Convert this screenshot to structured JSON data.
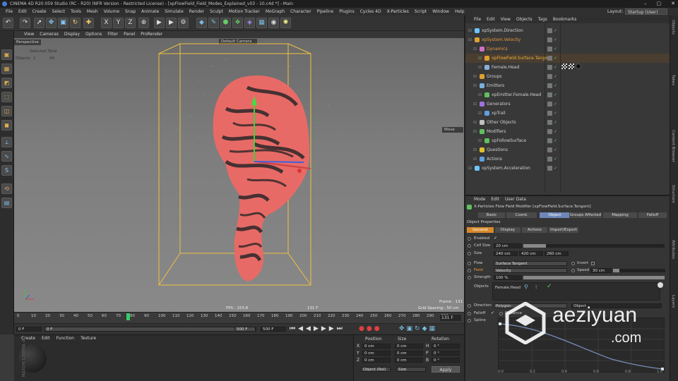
{
  "window": {
    "title": "CINEMA 4D R20.059 Studio (RC - R20) (NFR Version - Restricted License) - [xpFlowField_Field_Modes_Explained_v03 - 10.c4d *] - Main",
    "min": "–",
    "max": "▢",
    "close": "✕"
  },
  "menu": [
    "File",
    "Edit",
    "Create",
    "Select",
    "Tools",
    "Mesh",
    "Volume",
    "Snap",
    "Animate",
    "Simulate",
    "Render",
    "Sculpt",
    "Motion Tracker",
    "MoGraph",
    "Character",
    "Pipeline",
    "Plugins",
    "Cycles 4D",
    "X-Particles",
    "Script",
    "Window",
    "Help"
  ],
  "layout": {
    "label": "Layout:",
    "value": "Startup (User)"
  },
  "viewport": {
    "menu": [
      "View",
      "Cameras",
      "Display",
      "Options",
      "Filter",
      "Panel",
      "ProRender"
    ],
    "name": "Perspective",
    "camera": "Default Camera",
    "stats_header": "Selected Total",
    "stats_label": "Objects",
    "stats_selected": "1",
    "stats_total": "40",
    "fps": "FPS : 153.8",
    "frame": "Frame : 131",
    "frame_mid": "131 F",
    "grid": "Grid Spacing : 50 cm",
    "move": "Move"
  },
  "timeline": {
    "ticks": [
      "0",
      "10",
      "20",
      "30",
      "40",
      "50",
      "60",
      "70",
      "80",
      "90",
      "100",
      "110",
      "120",
      "130",
      "140",
      "150",
      "160",
      "170",
      "180",
      "190",
      "200",
      "210",
      "220",
      "230",
      "240",
      "250",
      "260",
      "270",
      "280",
      "290",
      "300"
    ],
    "current": "131 F"
  },
  "playback": {
    "start": "0 F",
    "min": "0 F",
    "max": "500 F",
    "end": "500 F"
  },
  "material": {
    "menu": [
      "Create",
      "Edit",
      "Function",
      "Texture"
    ],
    "brand": "MAXON CINEMA 4D"
  },
  "coords": {
    "headers": [
      "Position",
      "Size",
      "Rotation"
    ],
    "rows": [
      {
        "axis": "X",
        "pos": "0 cm",
        "size": "0 cm",
        "rotlabel": "H",
        "rot": "0 °"
      },
      {
        "axis": "Y",
        "pos": "0 cm",
        "size": "0 cm",
        "rotlabel": "P",
        "rot": "0 °"
      },
      {
        "axis": "Z",
        "pos": "0 cm",
        "size": "0 cm",
        "rotlabel": "B",
        "rot": "0 °"
      }
    ],
    "mode": "Object (Rel)",
    "sizemode": "Size",
    "apply": "Apply"
  },
  "objects": {
    "menu": [
      "File",
      "Edit",
      "View",
      "Objects",
      "Tags",
      "Bookmarks"
    ],
    "items": [
      {
        "name": "xpSystem.Direction",
        "indent": 0,
        "color": "#6dc4ff",
        "name_color": "#d0d0d0"
      },
      {
        "name": "xpSystem.Velocity",
        "indent": 0,
        "color": "#e0a030",
        "name_color": "#e89a3a"
      },
      {
        "name": "Dynamics",
        "indent": 1,
        "color": "#d070c0",
        "name_color": "#e89a3a"
      },
      {
        "name": "xpFlowField.Surface.Tangent",
        "indent": 2,
        "color": "#e0a030",
        "name_color": "#f0b040"
      },
      {
        "name": "Female.Head",
        "indent": 2,
        "color": "#8ab0e0",
        "name_color": "#d0d0d0"
      },
      {
        "name": "Groups",
        "indent": 1,
        "color": "#e0a030",
        "name_color": "#d0d0d0"
      },
      {
        "name": "Emitters",
        "indent": 1,
        "color": "#7ab0e0",
        "name_color": "#d0d0d0"
      },
      {
        "name": "xpEmitter.Female.Head",
        "indent": 2,
        "color": "#60c060",
        "name_color": "#d0d0d0"
      },
      {
        "name": "Generators",
        "indent": 1,
        "color": "#a070e0",
        "name_color": "#d0d0d0"
      },
      {
        "name": "xpTrail",
        "indent": 2,
        "color": "#60a0e0",
        "name_color": "#d0d0d0"
      },
      {
        "name": "Other Objects",
        "indent": 1,
        "color": "#c0c0c0",
        "name_color": "#d0d0d0"
      },
      {
        "name": "Modifiers",
        "indent": 1,
        "color": "#60c060",
        "name_color": "#d0d0d0"
      },
      {
        "name": "xpFollowSurface",
        "indent": 2,
        "color": "#60c060",
        "name_color": "#d0d0d0"
      },
      {
        "name": "Questions",
        "indent": 1,
        "color": "#e0c030",
        "name_color": "#d0d0d0"
      },
      {
        "name": "Actions",
        "indent": 1,
        "color": "#60a0e0",
        "name_color": "#d0d0d0"
      },
      {
        "name": "xpSystem.Acceleration",
        "indent": 0,
        "color": "#6dc4ff",
        "name_color": "#d0d0d0"
      }
    ]
  },
  "attributes": {
    "menu": [
      "Mode",
      "Edit",
      "User Data"
    ],
    "title": "X-Particles Flow Field Modifier [xpFlowField.Surface.Tangent]",
    "tabs": [
      "Basic",
      "Coord.",
      "Object",
      "Groups Affected",
      "Mapping",
      "Falloff"
    ],
    "subtabs": [
      "General",
      "Display",
      "Actions",
      "Import/Export"
    ],
    "section": "Object Properties",
    "enabled_label": "Enabled",
    "enabled_value": "✓",
    "cellsize_label": "Cell Size",
    "cellsize_value": "20 cm",
    "size_label": "Size",
    "size_x": "240 cm",
    "size_y": "420 cm",
    "size_z": "260 cm",
    "flow_label": "Flow",
    "flow_value": "Surface Tangent",
    "invert_label": "Invert",
    "field_label": "Field",
    "field_value": "Velocity",
    "speed_label": "Speed",
    "speed_value": "30 cm",
    "strength_label": "Strength",
    "strength_value": "100 %",
    "objects_label": "Objects",
    "objects_value": "Female.Head",
    "direction_label": "Direction",
    "direction_value": "Polygon",
    "direction_obj": "Object",
    "falloff_label": "Falloff",
    "distance_label": "Distance",
    "spline_label": "Spline",
    "curve_ticks": [
      "0.0",
      "0.2",
      "0.4",
      "0.6",
      "0.8",
      "1.0"
    ],
    "curve_value_ticks": [
      "1.0",
      "0.8",
      "0.6",
      "0.4",
      "0.2"
    ]
  },
  "right_tabs": [
    "Objects",
    "Takes",
    "Content Browser",
    "Structure",
    "Attributes",
    "Layers"
  ],
  "watermark": {
    "line1": "aeziyuan",
    "line2": ".com"
  }
}
